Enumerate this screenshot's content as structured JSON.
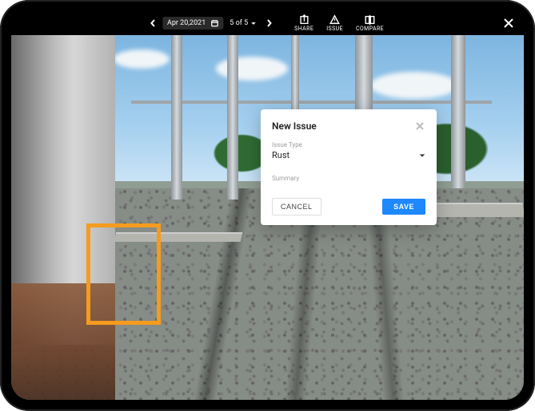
{
  "toolbar": {
    "date": "Apr 20,2021",
    "page_indicator": "5 of 5",
    "actions": {
      "share": "SHARE",
      "issue": "ISSUE",
      "compare": "COMPARE"
    }
  },
  "modal": {
    "title": "New Issue",
    "issue_type_label": "Issue Type",
    "issue_type_value": "Rust",
    "summary_label": "Summary",
    "summary_value": "",
    "cancel_label": "CANCEL",
    "save_label": "SAVE"
  },
  "highlight": {
    "color": "#f59b1e"
  }
}
